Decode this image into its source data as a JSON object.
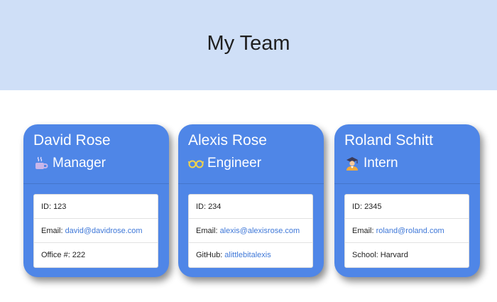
{
  "header": {
    "title": "My Team"
  },
  "colors": {
    "header_bg": "#cfdff7",
    "card_bg": "#4f86e7",
    "link": "#3f78d8"
  },
  "cards": [
    {
      "name": "David Rose",
      "role": "Manager",
      "icon": "coffee-cup-icon",
      "items": [
        {
          "label": "ID:",
          "value": "123"
        },
        {
          "label": "Email:",
          "value": "david@davidrose.com"
        },
        {
          "label": "Office #:",
          "value": "222"
        }
      ]
    },
    {
      "name": "Alexis Rose",
      "role": "Engineer",
      "icon": "glasses-icon",
      "items": [
        {
          "label": "ID:",
          "value": "234"
        },
        {
          "label": "Email:",
          "value": "alexis@alexisrose.com"
        },
        {
          "label": "GitHub:",
          "value": "alittlebitalexis"
        }
      ]
    },
    {
      "name": "Roland Schitt",
      "role": "Intern",
      "icon": "graduate-icon",
      "items": [
        {
          "label": "ID:",
          "value": "2345"
        },
        {
          "label": "Email:",
          "value": "roland@roland.com"
        },
        {
          "label": "School:",
          "value": "Harvard"
        }
      ]
    }
  ]
}
